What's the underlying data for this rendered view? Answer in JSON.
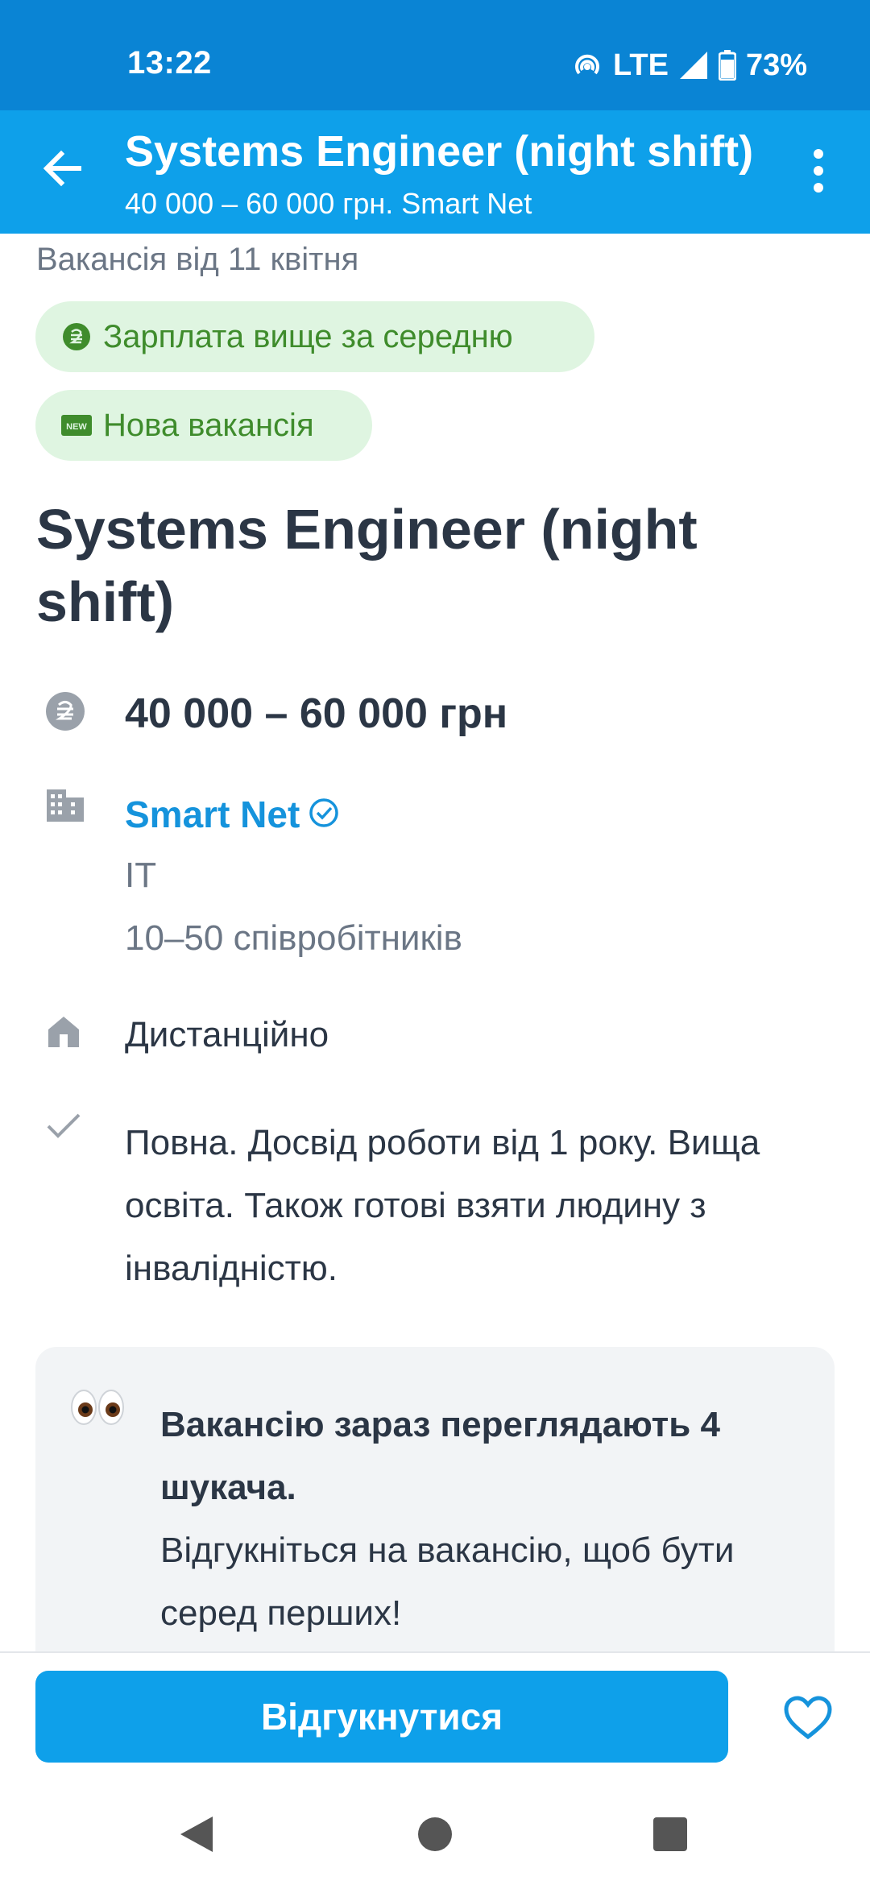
{
  "status_bar": {
    "time": "13:22",
    "network": "LTE",
    "battery": "73%",
    "icons": [
      "hotspot-icon",
      "signal-icon",
      "battery-icon"
    ]
  },
  "app_bar": {
    "title": "Systems Engineer (night shift)",
    "subtitle": "40 000 – 60 000 грн. Smart Net",
    "back_icon": "arrow-back-icon",
    "more_icon": "more-vert-icon"
  },
  "vacancy": {
    "posted": "Вакансія від 11 квітня",
    "badges": [
      {
        "label": "Зарплата вище за середню",
        "icon": "hryvnia-circle-icon"
      },
      {
        "label": "Нова вакансія",
        "icon": "new-badge-icon"
      }
    ],
    "title": "Systems Engineer (night shift)",
    "salary": "40 000 – 60 000 грн",
    "company": {
      "name": "Smart Net",
      "verified": true,
      "industry": "IT",
      "size": "10–50 співробітників"
    },
    "work_mode": "Дистанційно",
    "requirements": "Повна. Досвід роботи від 1 року. Вища освіта. Також готові взяти людину з інвалідністю."
  },
  "viewers_card": {
    "icon": "eyes-emoji",
    "bold_text": "Вакансію зараз переглядають 4 шукача.",
    "text": "Відгукніться на вакансію, щоб бути серед перших!"
  },
  "bottom_bar": {
    "apply_label": "Відгукнутися",
    "favorite_icon": "heart-outline-icon"
  },
  "colors": {
    "status_bar": "#0a84d4",
    "app_bar": "#0ea0ea",
    "accent": "#1593dc",
    "chip_bg": "#dff5e1",
    "chip_text": "#3f8c2c",
    "card_bg": "#f2f4f6"
  }
}
